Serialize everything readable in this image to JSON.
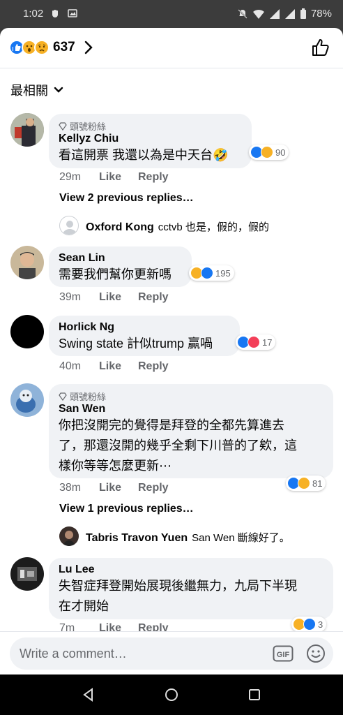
{
  "status_bar": {
    "time": "1:02",
    "battery": "78%"
  },
  "reactions_header": {
    "total": "637",
    "icons": [
      "like-icon",
      "wow-icon",
      "sad-icon"
    ]
  },
  "sort": {
    "label": "最相關"
  },
  "comments": [
    {
      "badge": "頭號粉絲",
      "author": "Kellyz Chiu",
      "text": "看這開票 我還以為是中天台🤣",
      "time": "29m",
      "like": "Like",
      "reply": "Reply",
      "reaction_count": "90",
      "view_replies": "View 2 previous replies…",
      "sub_reply": {
        "author": "Oxford Kong",
        "text": "cctvb 也是，假的，假的"
      }
    },
    {
      "author": "Sean Lin",
      "text": "需要我們幫你更新嗎",
      "time": "39m",
      "like": "Like",
      "reply": "Reply",
      "reaction_count": "195"
    },
    {
      "author": "Horlick Ng",
      "text": "Swing state 計似trump 贏喎",
      "time": "40m",
      "like": "Like",
      "reply": "Reply",
      "reaction_count": "17"
    },
    {
      "badge": "頭號粉絲",
      "author": "San Wen",
      "text_lines": [
        "你把沒開完的覺得是拜登的全都先算進去",
        "了，那還沒開的幾乎全剩下川普的了欸，這",
        "樣你等等怎麼更新⋯"
      ],
      "time": "38m",
      "like": "Like",
      "reply": "Reply",
      "reaction_count": "81",
      "view_replies": "View 1 previous replies…",
      "sub_reply": {
        "author": "Tabris Travon Yuen",
        "text": "San Wen 斷線好了。"
      }
    },
    {
      "author": "Lu Lee",
      "text_lines": [
        "失智症拜登開始展現後繼無力，九局下半現",
        "在才開始"
      ],
      "time": "7m",
      "like": "Like",
      "reply": "Reply",
      "reaction_count": "3"
    }
  ],
  "input": {
    "placeholder": "Write a comment…"
  },
  "colors": {
    "like_blue": "#1877f2",
    "haha_yellow": "#f7b125",
    "love_red": "#f33e58",
    "bubble_gray": "#f0f2f5"
  }
}
